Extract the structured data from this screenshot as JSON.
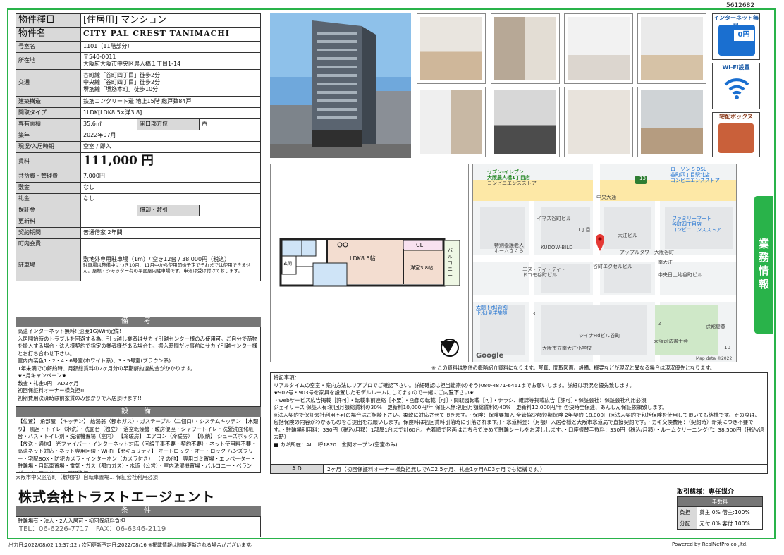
{
  "doc_id": "5612682",
  "property": {
    "rows": [
      {
        "label": "物件種目",
        "value": "[住居用] マンション",
        "big": true
      },
      {
        "label": "物件名",
        "value": "CITY PAL CREST TANIMACHI",
        "big": true,
        "name": true
      },
      {
        "label": "号室名",
        "value": "1101（11階部分）"
      },
      {
        "label": "所在地",
        "value_lines": [
          "〒540-0011",
          "大阪府大阪市中央区農人橋１丁目1-14"
        ]
      },
      {
        "label": "交通",
        "value_lines": [
          "谷町線「谷町四丁目」徒歩2分",
          "中央線「谷町四丁目」徒歩2分",
          "堺筋線「堺筋本町」徒歩10分"
        ]
      },
      {
        "label": "建築構造",
        "value": "鉄筋コンクリート造 地上15階 総戸数84戸"
      },
      {
        "label": "間取タイプ",
        "value": "1LDK[LDK8.5×洋3.8]"
      },
      {
        "label": "専有面積",
        "value": "35.6㎡",
        "sub_label": "開口部方位",
        "sub_value": "西"
      },
      {
        "label": "築年",
        "value": "2022年07月"
      },
      {
        "label": "現況/入居時期",
        "value": "空室 / 即入"
      },
      {
        "label": "賃料",
        "value": "111,000 円",
        "rent": true
      },
      {
        "label": "共益費・管理費",
        "value": "7,000円"
      },
      {
        "label": "敷金",
        "value": "なし"
      },
      {
        "label": "礼金",
        "value": "なし"
      },
      {
        "label": "保証金",
        "value": "",
        "sub_label": "償却・敷引",
        "sub_value": ""
      },
      {
        "label": "更新料",
        "value": ""
      },
      {
        "label": "契約期間",
        "value": "普通借家 2年間"
      },
      {
        "label": "町内会費",
        "value": ""
      },
      {
        "label": "駐車場",
        "value_lines": [
          "敷地外専用駐車場（1m）/ 空き12台 / 38,000円（税込）",
          "駐車場は整備中につき10月、11月中から使用開始予定でそれまでは使用できません。屋根・シャッター有の平面屋内駐車場です。申込は受け付けております。"
        ]
      }
    ]
  },
  "remarks": {
    "title": "備　考",
    "lines": [
      "高速インターネット無料!(速度1G)Wifi完備!",
      "入居開始時のトラブルを回避する為、引っ越し業者はサカイ引越センター様のみ使用可。ご自分で荷物を搬入する場合・法人様契約で指定の業者様がある場合も、搬入時間だけ事前にサカイ引越センター様とお打ち合わせ下さい。",
      "室内内装色1・2・4・6号室(ホワイト系)、3・5号室(ブラウン系)",
      "1年未満での解約時、月額総賃料の2ヶ月分の早期解約違約金がかかります。",
      "★8月キャンペーン★",
      "敷金・礼金0円　AD2ヶ月",
      "初回保証料オーナー様負担!!",
      "初期費用決済時は前家賃のみ預かりで入居頂けます!!"
    ]
  },
  "facilities": {
    "title": "設　備",
    "text": "【位置】 角部屋 【キッチン】 給湯器（都市ガス）・ガステーブル（二個口）・システムキッチン 【水廻り】 風呂・トイレ（水洗）・洗面台（独立）・浴室乾燥機・暖房便座・シャワートイレ・洗髪洗面化粧台・バス・トイレ別・洗濯機置場（室内） 【冷暖房】 エアコン（冷暖房） 【収納】 シューズボックス 【放送・通信】 光ファイバー・インターネット対応（回線工事不要・契約不要）・ネット使用料不要・高速ネット対応・ネット専用回線・Wi-Fi 【セキュリティ】 オートロック・オートロック ハンズフリー・宅配BOX・防犯カメラ・インターホン（カメラ付き） 【その他】 専用ゴミ置場・エレベーター・駐輪場・自転車置場・電気・ガス（都市ガス）・水道（公営）・室内洗濯機置場・バルコニー・ベランダ・バリアフリー 24時間換気シ"
  },
  "conditions": {
    "title": "条　件",
    "text": "駐輪場有・法人・2人入居可・初回保証料負担",
    "overlap_text": "大阪市中央区谷町（敷地内）自転車置場… 保証会社利用必須"
  },
  "company": {
    "name": "株式会社トラストエージェント",
    "tel": "TEL：06-6226-7717　FAX：06-6346-2119"
  },
  "badges": {
    "internet": "インターネット無料",
    "internet_fee": "0円",
    "wifi": "Wi-Fi設置",
    "delivery": "宅配ボックス"
  },
  "floorplan": {
    "ldk": "LDK8.5帖",
    "western": "洋室3.8帖",
    "closet": "CL",
    "balcony": "バルコニー",
    "entrance": "玄関"
  },
  "map": {
    "labels": [
      "セブン-イレブン",
      "大阪農人橋1丁目店",
      "コンビニエンスストア",
      "中央大通",
      "ローソン S OSL",
      "谷町四丁目駅北店",
      "コンビニエンスストア",
      "ファミリーマート",
      "谷町四丁目店",
      "コンビニエンスストア",
      "イマス谷町ビル",
      "1丁目",
      "大江ビル",
      "特別養護老人",
      "ホームさくら",
      "KUDOW-BILD",
      "アップルタワー大阪谷町",
      "エヌ・ティ・ティ・",
      "ドコモ谷町ビル",
      "谷町エクセルビル",
      "南大江",
      "中央日土地谷町ビル",
      "太閤下水(背割",
      "下水)見学施設",
      "シイナHdビル谷町",
      "大阪市立南大江小学校",
      "大阪司法書士会",
      "成都屋菓",
      "2",
      "3",
      "10",
      "Google",
      "Map data ©2022"
    ],
    "route": "13",
    "disclaimer": "※ この資料は物件の概略紹介資料になります。写真、間取図面、設備、概要などが現況と異なる場合は現況優先となります。"
  },
  "side_label": "業務情報",
  "notes": {
    "lines": [
      "特記事項：",
      "リアルタイムの空室・案内方法はリアプロでご確認下さい。詳細確認は担当能宗(のそう)080-4871-6461までお願いします。詳細は現況を優先致します。",
      "★902号・903号を家具を設置したモデルルームにしてますので一緒にご内覧下さい★",
      "・webサービス広告掲載［許可］・転載事前連絡［不要］・画像の転載［可］・間取図転載［可］・チラシ、雑誌等掲載広告［許可］・保証会社：保証会社利用必須",
      "ジェイリース 保証人有:初回月額総賃料の30%　更新料10,000円/年 保証人無:初回月額総賃料の40%　更新料12,000円/年 否決時全保連、あんしん保証依頼致します。",
      "※法人契約で保証会社利用不可の場合はご相談下さい。柔軟に対応させて頂きます。・保険：保険要加入 全管協少額短期保険 2年契約 18,000円(※法人契約で包括保険を使用して頂いても結構です。その際は、包括保険の内容がわかるものをご提出をお願いします。保険料は初回賃料引落時に引落されます。)・水道料金：（月額）入居者様と大阪市水道局で直接契約です。・カギ交換費用：（契約時）新築につき不要です。・駐輪場利用料：330円（税込/月額）1部屋1台まで計60台。先着順で区画はこちらで決めて駐輪シールをお渡しします。・口座振替手数料：330円（税込/月額）・ルームクリーニング代：38,500円（税込/退去時）",
      "■ カギ所在：AL　呼1820　玄関オープン(空室のみ)"
    ]
  },
  "ad": {
    "label": "A D",
    "value": "2ヶ月（初回保証料オーナー様負担無しでAD2.5ヶ月、礼金1ヶ月AD3ヶ月でも結構です。）"
  },
  "transaction": {
    "title": "取引態様：専任媒介",
    "fee_title": "手数料",
    "rows": [
      {
        "label": "負担",
        "value": "貸主:0% 借主:100%"
      },
      {
        "label": "分配",
        "value": "元付:0% 客付:100%"
      }
    ]
  },
  "footer": {
    "left": "出力日:2022/08/02 15:37:12 / 次回更新予定日:2022/08/16 ※掲載情報は随時更新される場合がございます。",
    "right": "Powered by RealNetPro co.,ltd."
  }
}
